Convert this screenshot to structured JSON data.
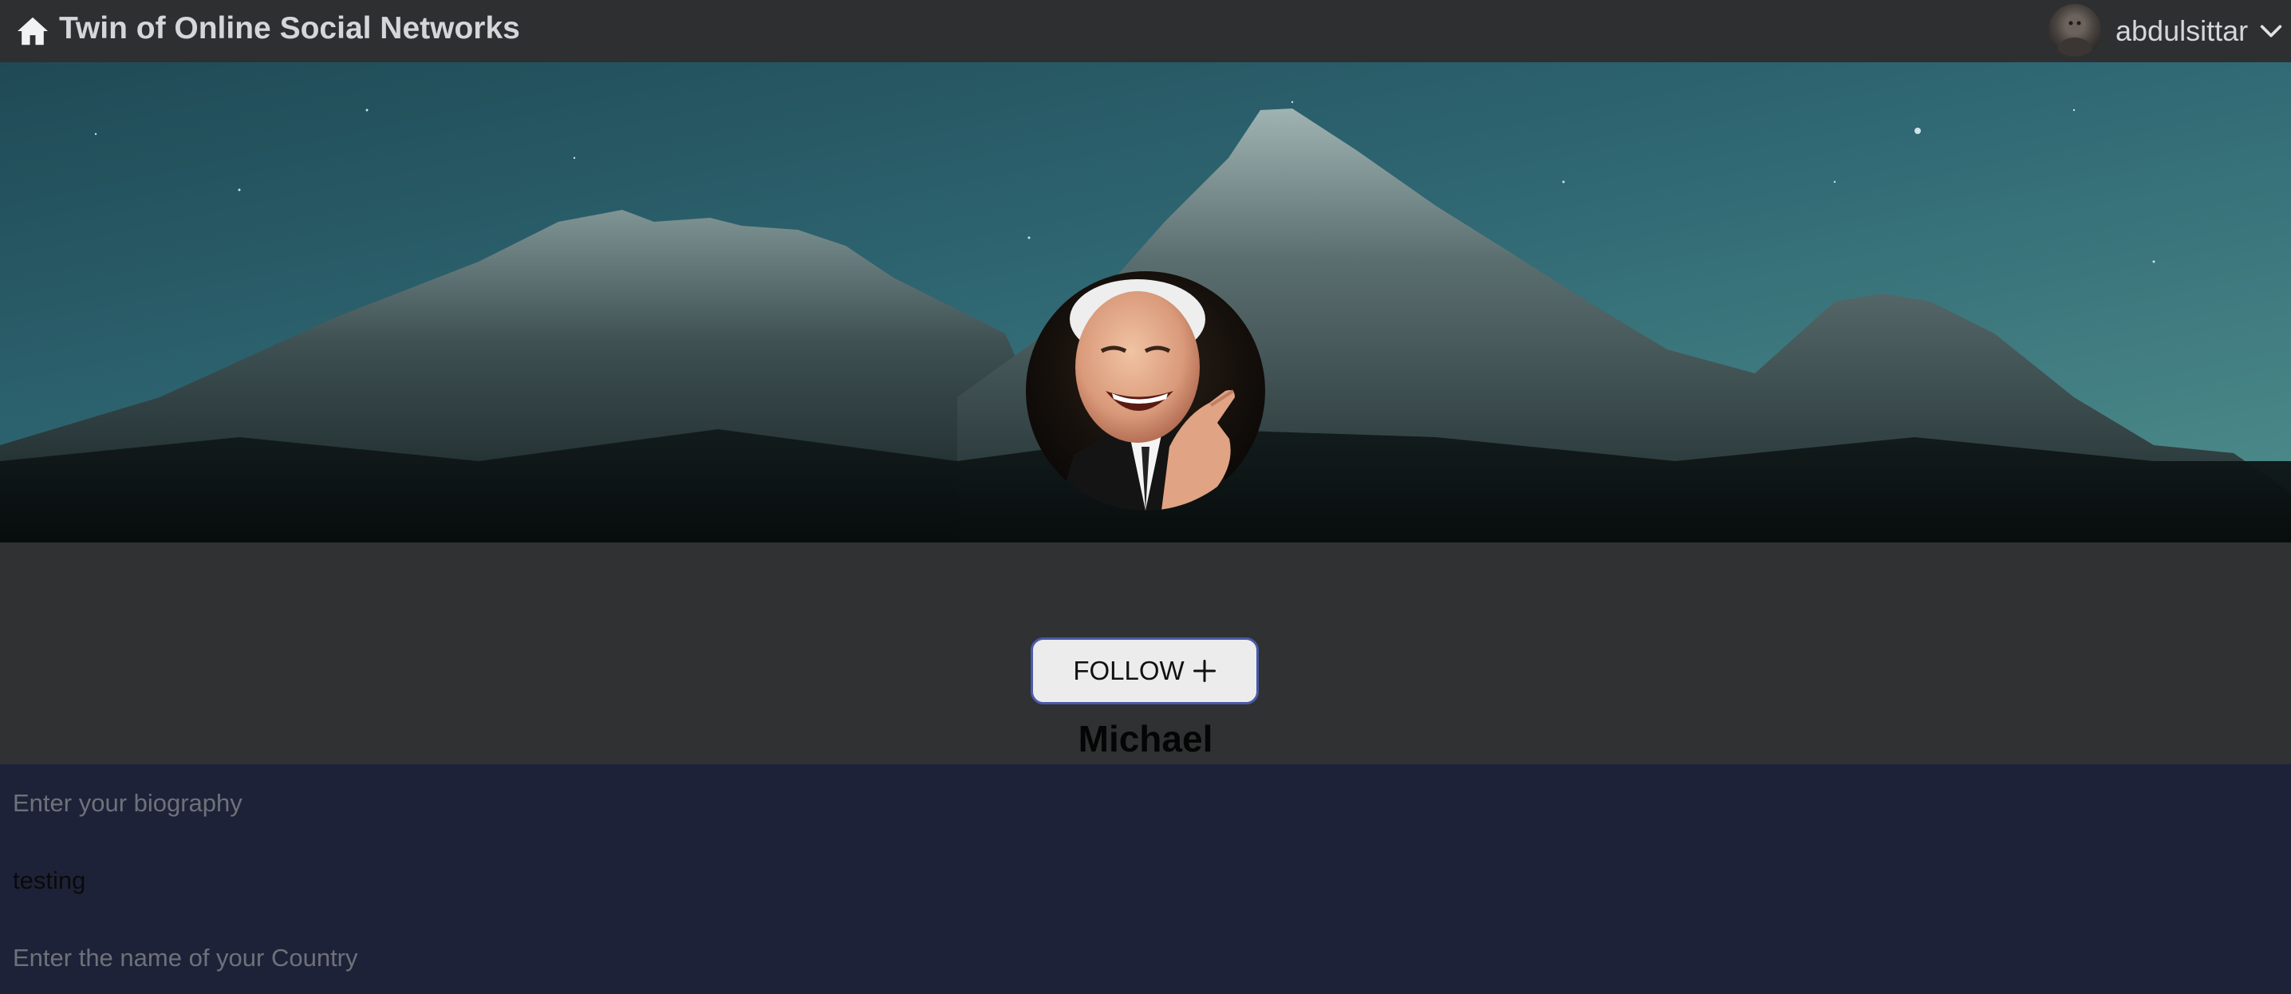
{
  "header": {
    "home_icon": "home-icon",
    "title": "Twin of Online Social Networks",
    "username": "abdulsittar",
    "menu_icon": "chevron-down-icon"
  },
  "profile": {
    "follow_label": "FOLLOW",
    "follow_icon": "plus-icon",
    "name": "Michael"
  },
  "form": {
    "biography_placeholder": "Enter your biography",
    "biography_value": "testing",
    "country_placeholder": "Enter the name of your Country",
    "country_value": ""
  },
  "colors": {
    "topbar": "#2d2f31",
    "band": "#2f3133",
    "form_bg": "#1e2238",
    "follow_border": "#4a5aa8"
  }
}
